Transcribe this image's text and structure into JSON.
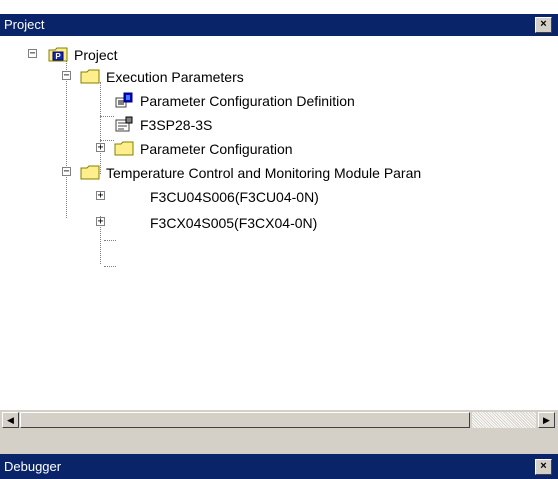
{
  "project_panel": {
    "title": "Project",
    "close": "×"
  },
  "tree": {
    "root": "Project",
    "execution_parameters": "Execution Parameters",
    "parameter_configuration_definition": "Parameter Configuration Definition",
    "f3sp28": "F3SP28-3S",
    "parameter_configuration": "Parameter Configuration",
    "temperature_control": "Temperature Control and Monitoring Module Paran",
    "f3cu04": "F3CU04S006(F3CU04-0N)",
    "f3cx04": "F3CX04S005(F3CX04-0N)"
  },
  "expander_symbols": {
    "minus": "−",
    "plus": "+"
  },
  "scrollbar": {
    "left_arrow": "◀",
    "right_arrow": "▶"
  },
  "debugger_panel": {
    "title": "Debugger",
    "close": "×"
  },
  "colors": {
    "titlebar": "#0a246a",
    "folder": "#ffef8c",
    "window_face": "#d4d0c8"
  }
}
